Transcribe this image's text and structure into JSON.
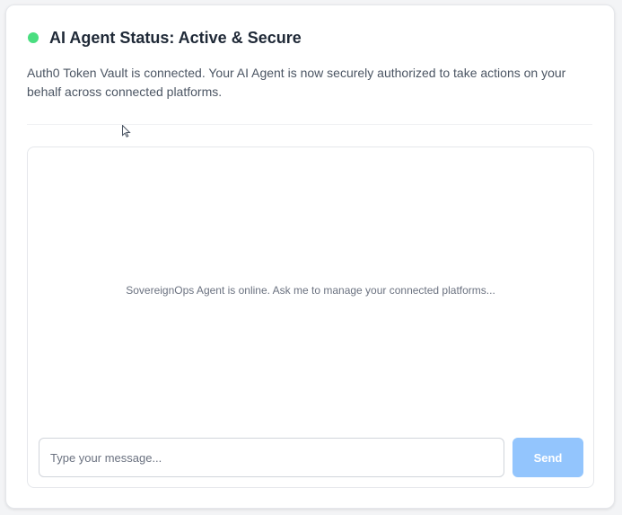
{
  "status": {
    "title": "AI Agent Status: Active & Secure",
    "indicator_color": "#4ade80",
    "description": "Auth0 Token Vault is connected. Your AI Agent is now securely authorized to take actions on your behalf across connected platforms."
  },
  "chat": {
    "empty_message": "SovereignOps Agent is online. Ask me to manage your connected platforms...",
    "input_value": "",
    "input_placeholder": "Type your message...",
    "send_label": "Send",
    "send_color": "#93c5fd"
  },
  "icons": {
    "status": "status-dot-icon",
    "cursor": "mouse-cursor-icon"
  }
}
